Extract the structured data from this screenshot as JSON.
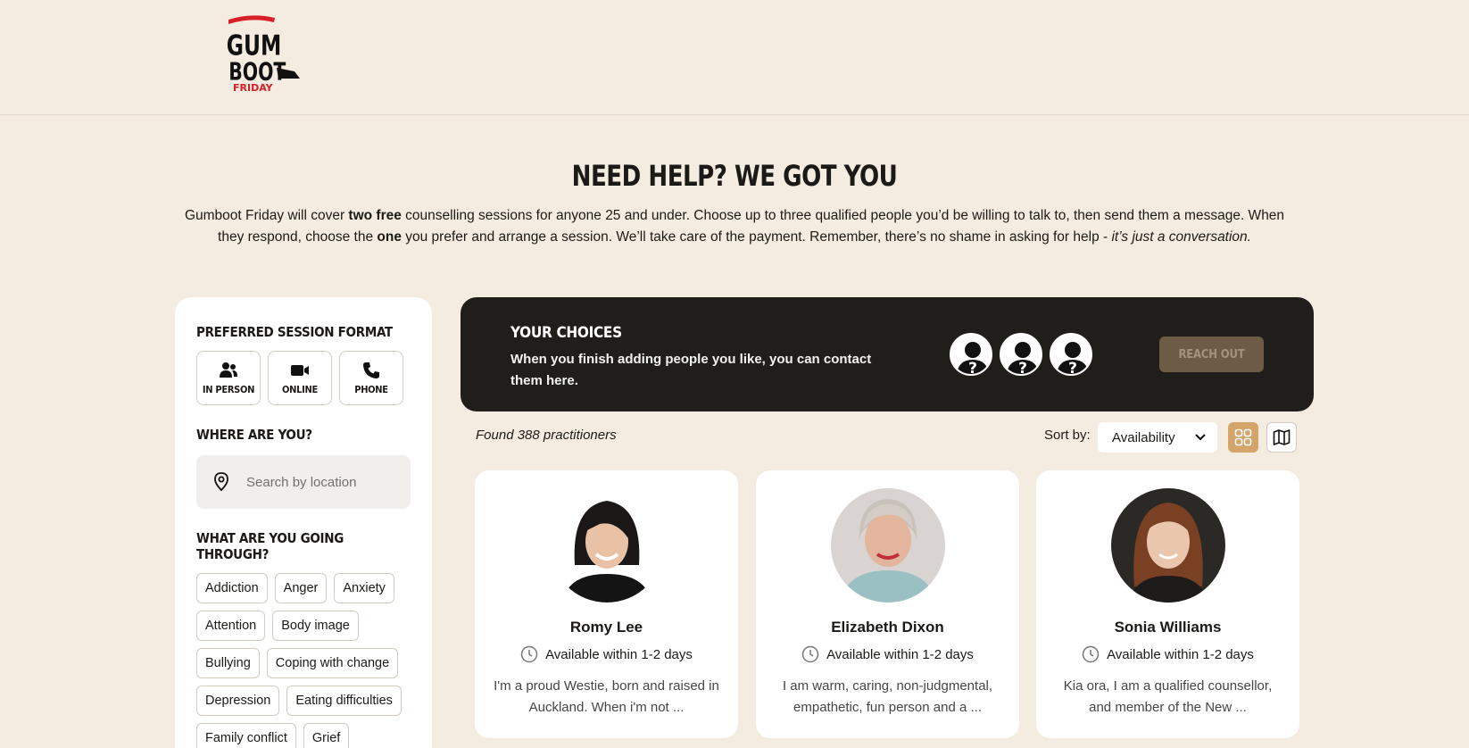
{
  "brand": {
    "logo_text_top": "GUM",
    "logo_text_mid": "BOOT",
    "logo_text_bottom": "FRIDAY"
  },
  "hero": {
    "title": "NEED HELP? WE GOT YOU",
    "intro_1": "Gumboot Friday will cover ",
    "intro_bold_1": "two free",
    "intro_2": " counselling sessions for anyone 25 and under. Choose up to three qualified people you’d be willing to talk to, then send them a message. When they respond, choose the ",
    "intro_bold_2": "one",
    "intro_3": " you prefer and arrange a session. We’ll take care of the payment. Remember, there’s no shame in asking for help - ",
    "intro_italic": "it’s just a conversation."
  },
  "sidebar": {
    "format_heading": "PREFERRED SESSION FORMAT",
    "formats": [
      {
        "label": "IN PERSON",
        "icon": "people-icon"
      },
      {
        "label": "ONLINE",
        "icon": "video-icon"
      },
      {
        "label": "PHONE",
        "icon": "phone-icon"
      }
    ],
    "location_heading": "WHERE ARE YOU?",
    "location_placeholder": "Search by location",
    "issues_heading": "WHAT ARE YOU GOING THROUGH?",
    "issues": [
      "Addiction",
      "Anger",
      "Anxiety",
      "Attention",
      "Body image",
      "Bullying",
      "Coping with change",
      "Depression",
      "Eating difficulties",
      "Family conflict",
      "Grief"
    ]
  },
  "choices": {
    "heading": "YOUR CHOICES",
    "text": "When you finish adding people you like, you can contact them here.",
    "slot_symbol": "?",
    "button": "REACH OUT"
  },
  "results": {
    "found": "Found 388 practitioners",
    "sort_label": "Sort by:",
    "sort_value": "Availability"
  },
  "practitioners": [
    {
      "name": "Romy Lee",
      "availability": "Available within 1-2 days",
      "bio": "I'm a proud Westie, born and raised in Auckland. When i'm not ..."
    },
    {
      "name": "Elizabeth Dixon",
      "availability": "Available within 1-2 days",
      "bio": "I am warm, caring, non-judgmental, empathetic, fun person and a ..."
    },
    {
      "name": "Sonia Williams",
      "availability": "Available within 1-2 days",
      "bio": "Kia ora, I am a qualified counsellor, and member of the New ..."
    }
  ],
  "colors": {
    "background": "#f4ece0",
    "panel_dark": "#201e1b",
    "accent": "#d4a46a",
    "reach_out_bg": "#6e5b45",
    "logo_red": "#d8202a"
  }
}
